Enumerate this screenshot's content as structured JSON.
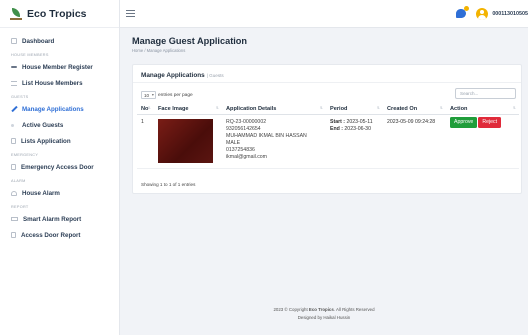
{
  "brand": {
    "name": "Eco Tropics"
  },
  "sidebar": {
    "items": [
      {
        "type": "item",
        "label": "Dashboard",
        "icon": "grid-icon"
      },
      {
        "type": "section",
        "label": "HOUSE MEMBERS"
      },
      {
        "type": "item",
        "label": "House Member Register",
        "icon": "user-card-icon"
      },
      {
        "type": "item",
        "label": "List House Members",
        "icon": "list-icon"
      },
      {
        "type": "section",
        "label": "GUESTS"
      },
      {
        "type": "item",
        "label": "Manage Applications",
        "icon": "pencil-icon",
        "active": true
      },
      {
        "type": "item",
        "label": "Active Guests",
        "icon": "dot-icon"
      },
      {
        "type": "item",
        "label": "Lists Application",
        "icon": "document-icon"
      },
      {
        "type": "section",
        "label": "EMERGENCY"
      },
      {
        "type": "item",
        "label": "Emergency Access Door",
        "icon": "door-icon"
      },
      {
        "type": "section",
        "label": "ALARM"
      },
      {
        "type": "item",
        "label": "House Alarm",
        "icon": "bell-icon"
      },
      {
        "type": "section",
        "label": "REPORT"
      },
      {
        "type": "item",
        "label": "Smart Alarm Report",
        "icon": "report-icon"
      },
      {
        "type": "item",
        "label": "Access Door Report",
        "icon": "report-doc-icon"
      }
    ]
  },
  "topbar": {
    "user_id": "000113010505"
  },
  "page": {
    "title": "Manage Guest Application",
    "breadcrumb": "Home / Manage Applications"
  },
  "card": {
    "title": "Manage Applications",
    "subtitle": "| Guests",
    "length_value": "10",
    "length_suffix": "entries per page",
    "search_placeholder": "Search...",
    "showing": "Showing 1 to 1 of 1 entries"
  },
  "table": {
    "headers": [
      "No",
      "Face Image",
      "Application Details",
      "Period",
      "Created On",
      "Action"
    ],
    "rows": [
      {
        "no": "1",
        "details": [
          "RQ-23-00000002",
          "932056142654",
          "MUHAMMAD IKMAL BIN HASSAN",
          "MALE",
          "0137254836",
          "ikmal@gmail.com"
        ],
        "period_start_label": "Start :",
        "period_start": "2023-05-11",
        "period_end_label": "End :",
        "period_end": "2023-06-30",
        "created_on": "2023-05-09 09:24:28",
        "approve_label": "Approve",
        "reject_label": "Reject"
      }
    ]
  },
  "footer": {
    "copyright_prefix": "2023 © Copyright",
    "copyright_brand": "Eco Tropics",
    "copyright_suffix": ". All Rights Reserved",
    "designed_by": "Designed by Haikal Hussin"
  },
  "colors": {
    "accent": "#2f6fd6",
    "approve": "#1f9d3a",
    "reject": "#e02a3a",
    "badge": "#f3b300"
  }
}
